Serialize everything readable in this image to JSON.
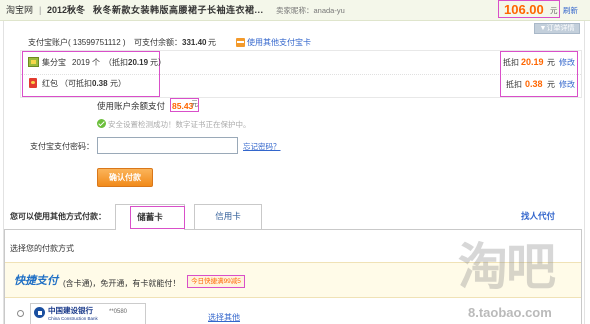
{
  "header": {
    "site_name": "淘宝网",
    "separator": "|",
    "season_tag": "2012秋冬",
    "item_title": "秋冬新款女装韩版高腰裙子长袖连衣裙...",
    "seller": "卖家昵称：anada-yu",
    "total_amount": "106.00",
    "currency": "元",
    "refresh_label": "刷新",
    "order_details_label": "▼订单详情"
  },
  "account": {
    "label": "支付宝账户( 13599751112 )",
    "balance_label": "可支付余额：",
    "balance_value": "331.40",
    "balance_unit": "元",
    "other_card_icon": "alipay-card-icon",
    "other_card_label": "使用其他支付宝卡"
  },
  "discounts": [
    {
      "icon": "jifenbao-icon",
      "name": "集分宝",
      "count": "2019 个",
      "note_prefix": "（抵扣",
      "note_value": "20.19",
      "note_suffix": "元）",
      "deduct_label": "抵扣",
      "deduct_value": "20.19",
      "unit": "元",
      "edit_label": "修改"
    },
    {
      "icon": "hongbao-icon",
      "name": "红包",
      "note_prefix": "（可抵扣",
      "note_value": "0.38",
      "note_suffix": "元）",
      "deduct_label": "抵扣",
      "deduct_value": "0.38",
      "unit": "元",
      "edit_label": "修改"
    }
  ],
  "balance_payment": {
    "label": "使用账户余额支付",
    "value": "85.43",
    "unit": "元"
  },
  "security": {
    "icon": "check-icon",
    "message": "安全设置检测成功！数字证书正在保护中。"
  },
  "password": {
    "label": "支付宝支付密码：",
    "forgot_label": "忘记密码？"
  },
  "confirm": {
    "label": "确认付款"
  },
  "other_methods": {
    "label": "您可以使用其他方式付款：",
    "tabs": [
      {
        "label": "储蓄卡",
        "active": true
      },
      {
        "label": "信用卡",
        "active": false
      }
    ],
    "pay_for_me_label": "找人代付"
  },
  "payment_panel": {
    "title": "选择您的付款方式",
    "quick_pay": {
      "logo_text": "快捷支付",
      "description": "(含卡通)，免开通，有卡就能付！",
      "promo": "今日快捷满99减5"
    },
    "bank_option": {
      "icon": "ccb-logo-icon",
      "bank_name": "中国建设银行",
      "bank_name_en": "China Construction Bank",
      "card_tail": "**0580"
    },
    "choose_other_label": "选择其他"
  },
  "watermark": {
    "text": "淘吧",
    "domain": "8.taobao.com"
  },
  "colors": {
    "accent": "#ff6600",
    "link": "#3366cc",
    "highlight_outline": "#d94fc9",
    "success": "#6cbf3c",
    "confirm_button": "#f18a1a"
  }
}
